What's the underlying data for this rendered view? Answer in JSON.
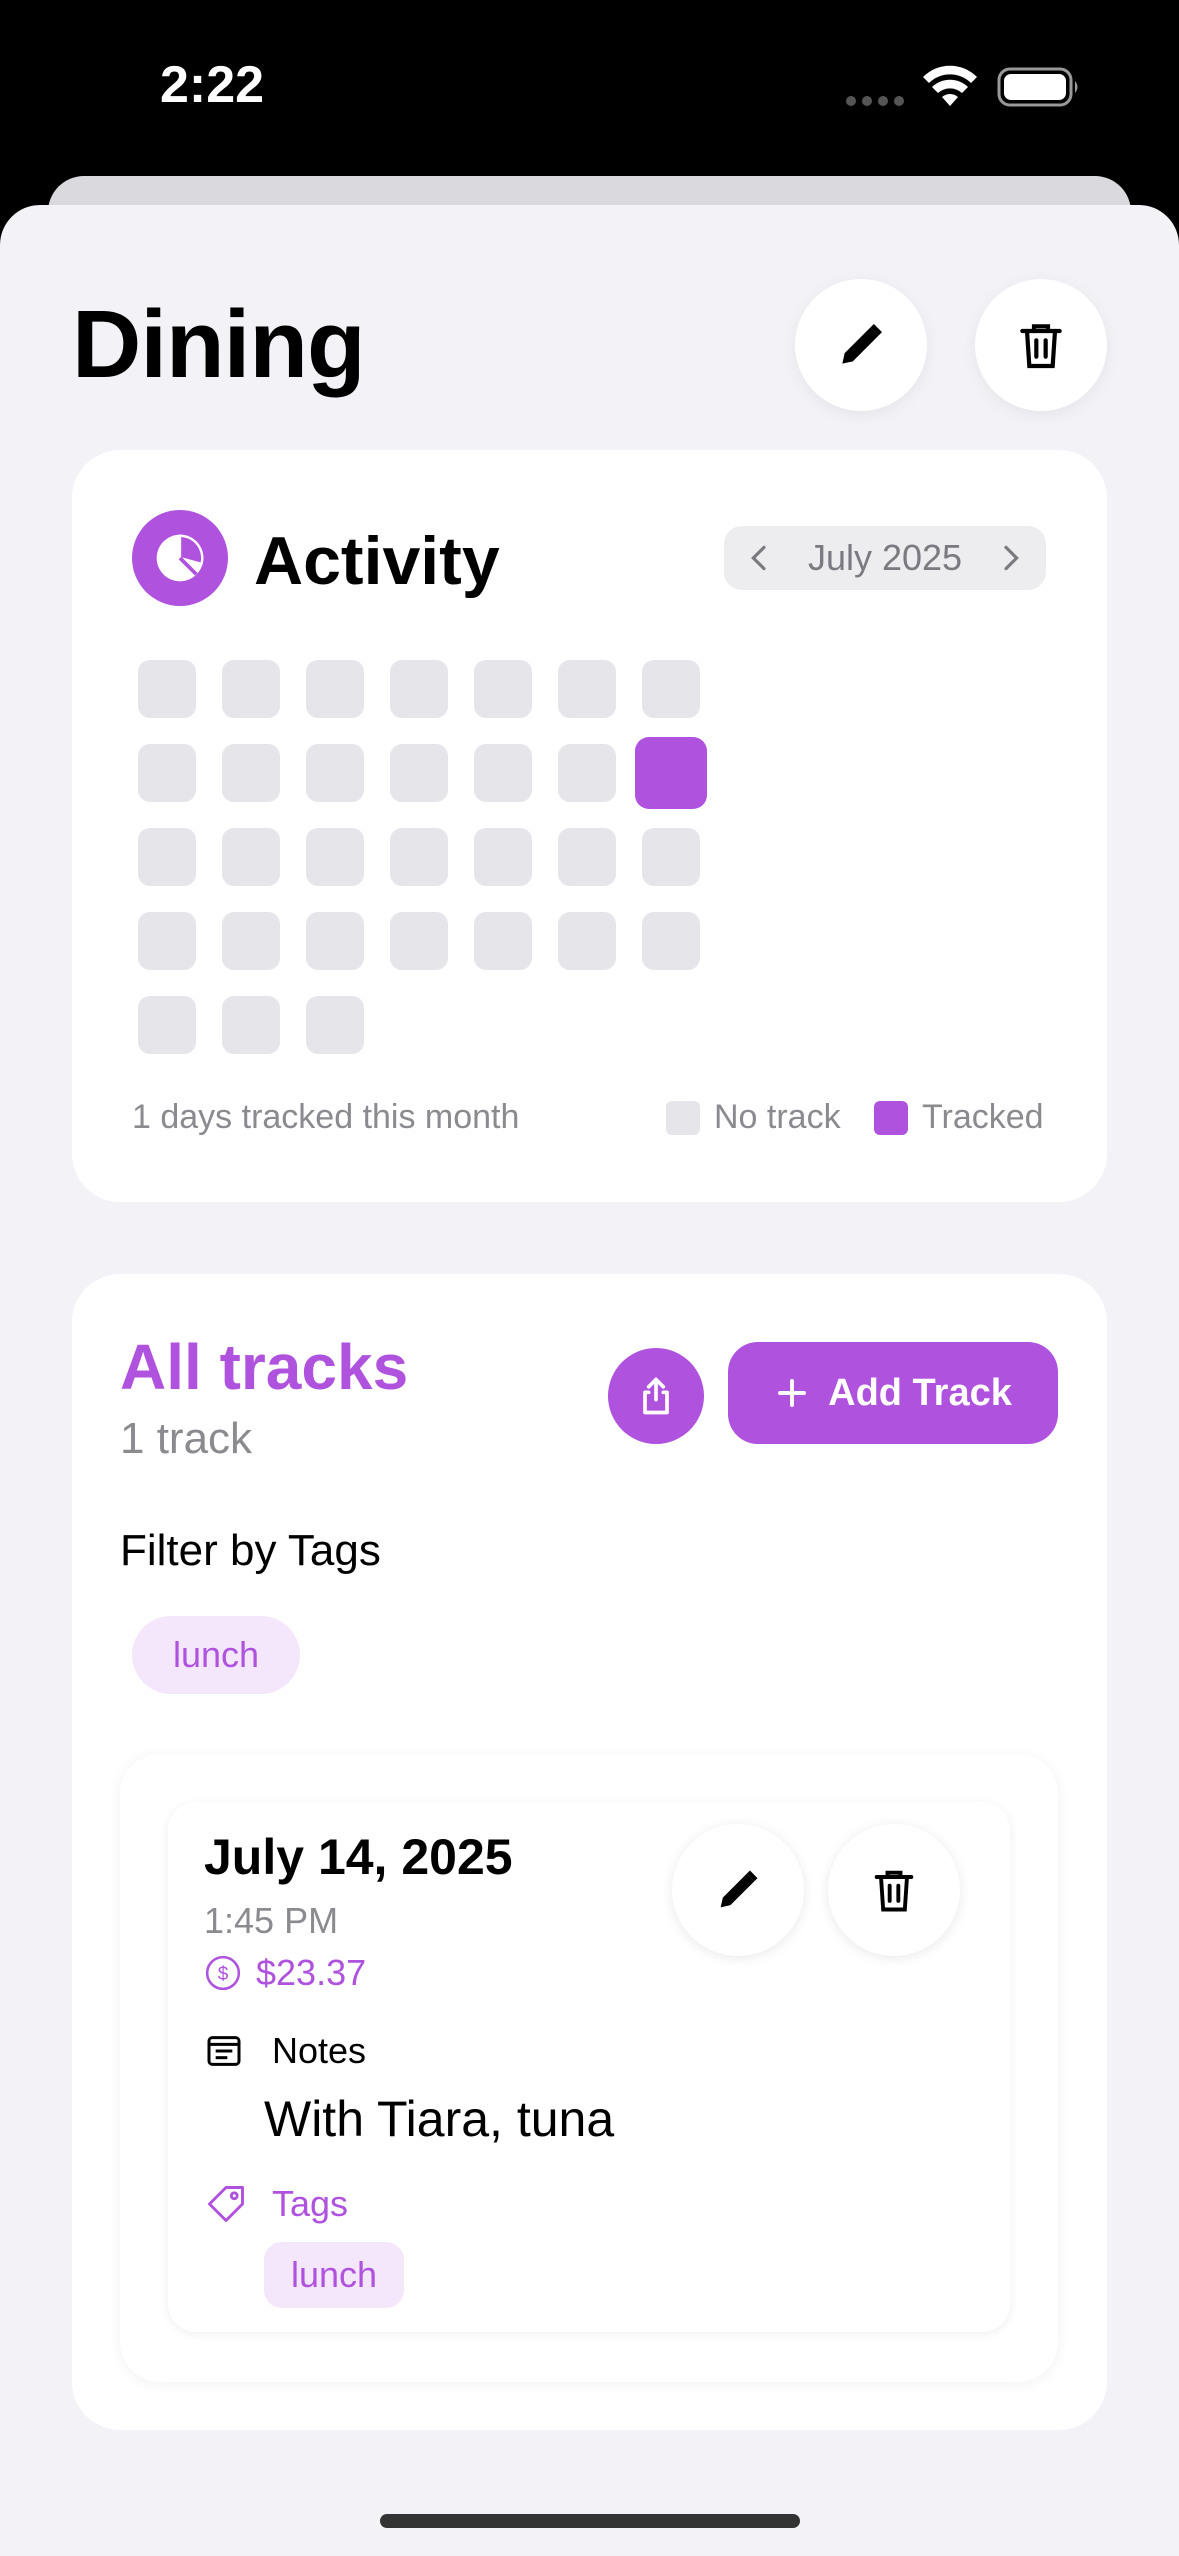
{
  "status_bar": {
    "time": "2:22"
  },
  "header": {
    "title": "Dining"
  },
  "activity": {
    "title": "Activity",
    "month_label": "July 2025",
    "days": [
      {
        "tracked": false
      },
      {
        "tracked": false
      },
      {
        "tracked": false
      },
      {
        "tracked": false
      },
      {
        "tracked": false
      },
      {
        "tracked": false
      },
      {
        "tracked": false
      },
      {
        "tracked": false
      },
      {
        "tracked": false
      },
      {
        "tracked": false
      },
      {
        "tracked": false
      },
      {
        "tracked": false
      },
      {
        "tracked": false
      },
      {
        "tracked": true
      },
      {
        "tracked": false
      },
      {
        "tracked": false
      },
      {
        "tracked": false
      },
      {
        "tracked": false
      },
      {
        "tracked": false
      },
      {
        "tracked": false
      },
      {
        "tracked": false
      },
      {
        "tracked": false
      },
      {
        "tracked": false
      },
      {
        "tracked": false
      },
      {
        "tracked": false
      },
      {
        "tracked": false
      },
      {
        "tracked": false
      },
      {
        "tracked": false
      },
      {
        "tracked": false
      },
      {
        "tracked": false
      },
      {
        "tracked": false
      }
    ],
    "summary": "1 days tracked this month",
    "legend_no_track": "No track",
    "legend_tracked": "Tracked"
  },
  "tracks": {
    "title": "All tracks",
    "count": "1 track",
    "add_button_label": "Add Track",
    "filter_label": "Filter by Tags",
    "filter_tags": [
      "lunch"
    ],
    "entries": [
      {
        "date": "July 14, 2025",
        "time": "1:45 PM",
        "amount": "$23.37",
        "notes_label": "Notes",
        "notes": "With Tiara, tuna",
        "tags_label": "Tags",
        "tags": [
          "lunch"
        ]
      }
    ]
  },
  "colors": {
    "accent": "#af52de",
    "cell_empty": "#e5e5ea",
    "background": "#f2f2f7"
  },
  "icons": [
    "pencil-icon",
    "trash-icon",
    "pie-chart-icon",
    "chevron-left-icon",
    "chevron-right-icon",
    "share-icon",
    "plus-icon",
    "dollar-circle-icon",
    "notes-icon",
    "tag-icon",
    "wifi-icon",
    "battery-icon"
  ]
}
